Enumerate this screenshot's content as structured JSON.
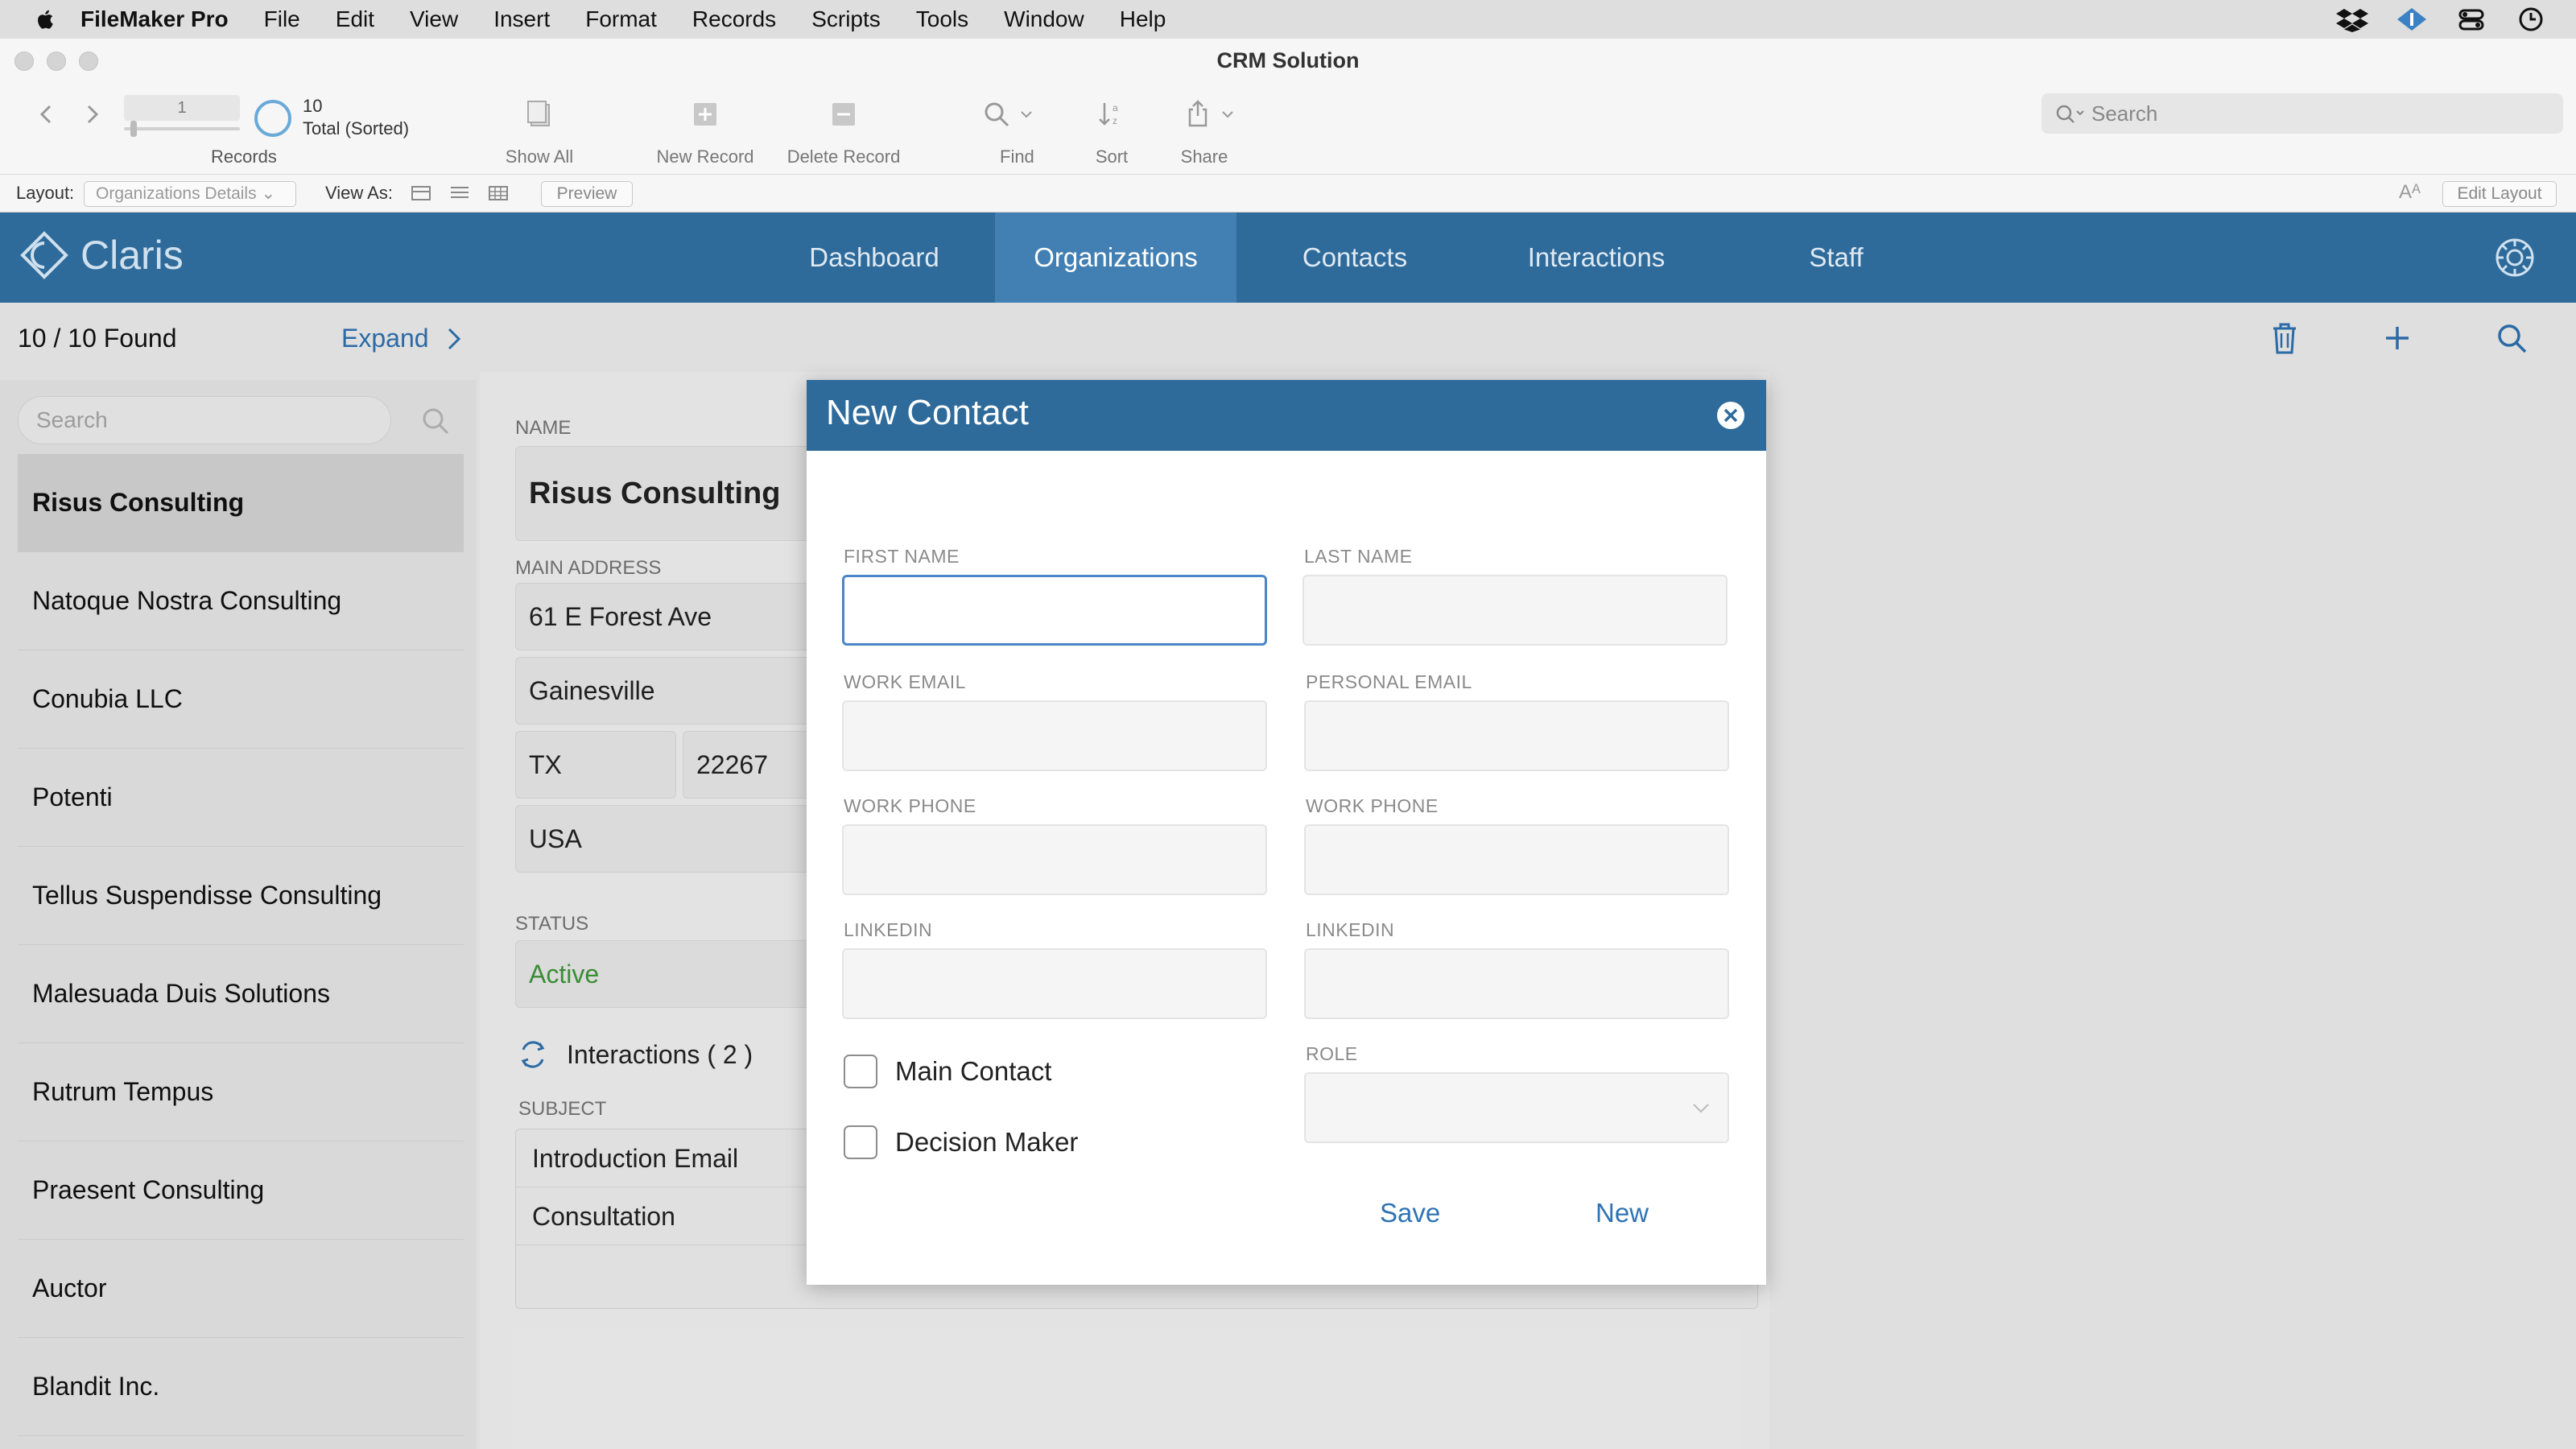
{
  "menubar": {
    "app_name": "FileMaker Pro",
    "items": [
      "File",
      "Edit",
      "View",
      "Insert",
      "Format",
      "Records",
      "Scripts",
      "Tools",
      "Window",
      "Help"
    ]
  },
  "window": {
    "title": "CRM Solution"
  },
  "toolbar": {
    "record_field": "1",
    "record_total": "10",
    "record_total_note": "Total (Sorted)",
    "records_label": "Records",
    "show_all": "Show All",
    "new_record": "New Record",
    "delete_record": "Delete Record",
    "find": "Find",
    "sort": "Sort",
    "share": "Share",
    "search_placeholder": "Search"
  },
  "layoutbar": {
    "layout_label": "Layout:",
    "layout_value": "Organizations Details",
    "view_as_label": "View As:",
    "preview": "Preview",
    "aa": "Aᴬ",
    "edit_layout": "Edit Layout"
  },
  "appnav": {
    "logo_text": "Claris",
    "tabs": [
      "Dashboard",
      "Organizations",
      "Contacts",
      "Interactions",
      "Staff"
    ],
    "active_tab": "Organizations"
  },
  "list": {
    "found": "10 / 10 Found",
    "expand": "Expand",
    "search_placeholder": "Search",
    "organizations": [
      "Risus Consulting",
      "Natoque Nostra Consulting",
      "Conubia LLC",
      "Potenti",
      "Tellus Suspendisse Consulting",
      "Malesuada Duis Solutions",
      "Rutrum Tempus",
      "Praesent Consulting",
      "Auctor",
      "Blandit Inc."
    ]
  },
  "detail": {
    "name_label": "NAME",
    "name": "Risus Consulting",
    "address_label": "MAIN ADDRESS",
    "street": "61 E Forest Ave",
    "city": "Gainesville",
    "state": "TX",
    "zip": "22267",
    "country": "USA",
    "status_label": "STATUS",
    "status": "Active",
    "interactions": "Interactions ( 2 )",
    "subject_label": "SUBJECT",
    "subjects": [
      "Introduction Email",
      "Consultation"
    ]
  },
  "modal": {
    "title": "New Contact",
    "first_name_label": "FIRST NAME",
    "last_name_label": "LAST NAME",
    "work_email_label": "WORK EMAIL",
    "personal_email_label": "PERSONAL EMAIL",
    "work_phone_label": "WORK PHONE",
    "work_phone2_label": "WORK PHONE",
    "linkedin_label": "LINKEDIN",
    "linkedin2_label": "LINKEDIN",
    "role_label": "ROLE",
    "main_contact": "Main Contact",
    "decision_maker": "Decision Maker",
    "save": "Save",
    "new": "New",
    "first_name": "",
    "last_name": "",
    "work_email": "",
    "personal_email": "",
    "work_phone": "",
    "work_phone2": "",
    "linkedin": "",
    "linkedin2": ""
  },
  "colors": {
    "brand_blue": "#2e6b9b",
    "active_tab": "#4280b3",
    "link_blue": "#2f73b3",
    "status_green": "#3f9a3a"
  },
  "icons": {
    "status": [
      "dropbox-icon",
      "network-icon",
      "control-center-icon",
      "clock-icon"
    ],
    "detail_actions": [
      "trash-icon",
      "plus-icon",
      "search-icon"
    ]
  }
}
